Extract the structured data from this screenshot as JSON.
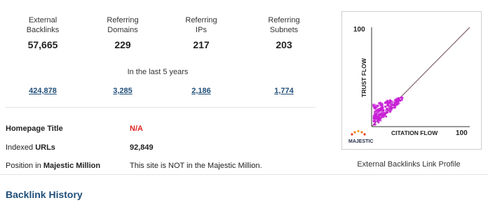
{
  "stats": [
    {
      "label": "External\nBacklinks",
      "value": "57,665"
    },
    {
      "label": "Referring\nDomains",
      "value": "229"
    },
    {
      "label": "Referring\nIPs",
      "value": "217"
    },
    {
      "label": "Referring\nSubnets",
      "value": "203"
    }
  ],
  "period_label": "In the last 5 years",
  "historic": [
    "424,878",
    "3,285",
    "2,186",
    "1,774"
  ],
  "info": {
    "homepage_title_label": "Homepage Title",
    "homepage_title_value": "N/A",
    "indexed_label_prefix": "Indexed ",
    "indexed_label_bold": "URLs",
    "indexed_value": "92,849",
    "position_label_prefix": "Position in ",
    "position_label_bold": "Majestic Million",
    "position_value": "This site is NOT in the Majestic Million."
  },
  "chart": {
    "y_max_label": "100",
    "x_max_label": "100",
    "y_axis_label": "TRUST FLOW",
    "x_axis_label": "CITATION FLOW",
    "logo_text": "MAJESTIC",
    "caption": "External Backlinks Link Profile",
    "point_color": "#c71fd6",
    "diag_color": "#8a6f74"
  },
  "section_title": "Backlink History"
}
